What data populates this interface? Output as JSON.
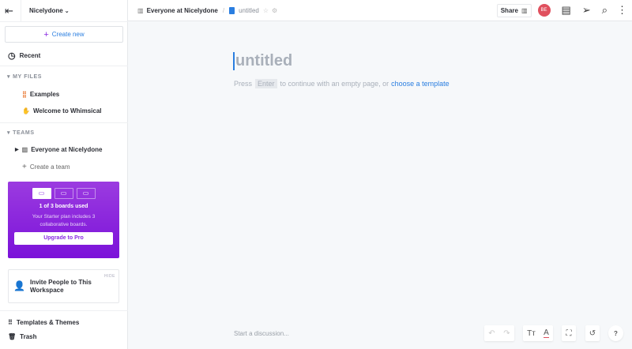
{
  "workspace": "Nicelydone",
  "create_new": "Create new",
  "recent": "Recent",
  "my_files": {
    "title": "MY FILES",
    "items": [
      "Examples",
      "Welcome to Whimsical"
    ]
  },
  "teams": {
    "title": "TEAMS",
    "items": [
      "Everyone at Nicelydone"
    ],
    "create": "Create a team"
  },
  "promo": {
    "used": "1 of 3 boards used",
    "desc": "Your Starter plan includes 3 collaborative boards.",
    "button": "Upgrade to Pro"
  },
  "invite": {
    "title": "Invite People to This Workspace",
    "hide": "HIDE"
  },
  "templates": "Templates & Themes",
  "trash": "Trash",
  "breadcrumb": {
    "team": "Everyone at Nicelydone",
    "sep": "/",
    "doc": "untitled"
  },
  "share": "Share",
  "avatar": "BE",
  "doc": {
    "title": "untitled",
    "hint_press": "Press",
    "hint_key": "Enter",
    "hint_mid": "to continue with an empty page, or",
    "hint_link": "choose a template"
  },
  "discussion": "Start a discussion...",
  "help": "?"
}
